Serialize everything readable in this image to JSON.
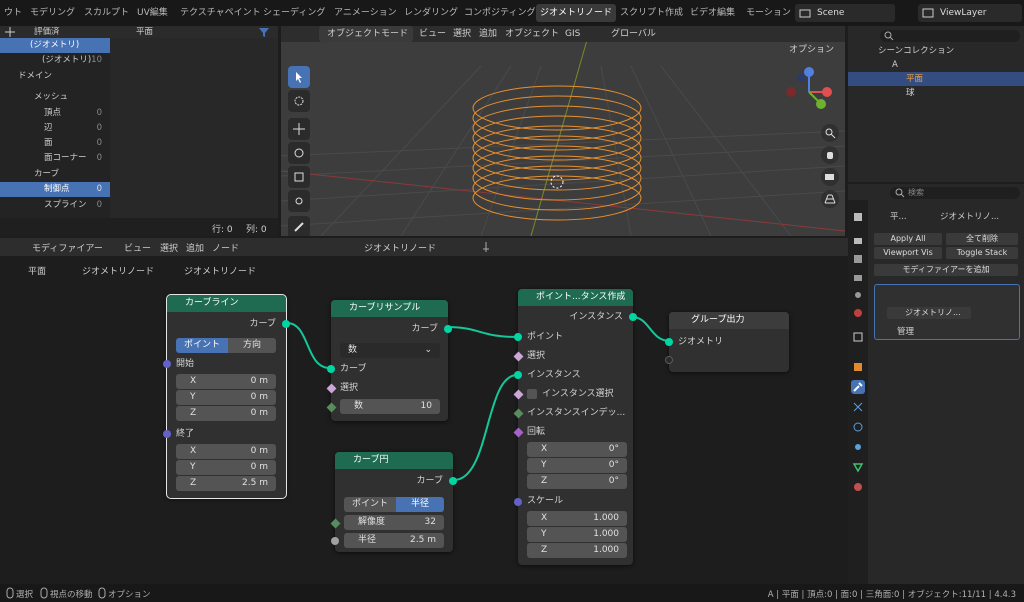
{
  "topbar": {
    "tabs": [
      "ウト",
      "モデリング",
      "スカルプト",
      "UV編集",
      "テクスチャペイント",
      "シェーディング",
      "アニメーション",
      "レンダリング",
      "コンポジティング",
      "ジオメトリノード",
      "スクリプト作成",
      "ビデオ編集",
      "モーション"
    ],
    "scene": "Scene",
    "view_layer": "ViewLayer"
  },
  "left_panel": {
    "header_label": "評価済",
    "rows": [
      {
        "label": "(ジオメトリ)",
        "count": "",
        "selected": true
      },
      {
        "label": "(ジオメトリ)",
        "count": "10",
        "selected": false
      },
      {
        "label": "ドメイン",
        "count": "",
        "selected": false
      },
      {
        "label": "メッシュ",
        "count": "",
        "selected": false
      },
      {
        "label": "頂点",
        "count": "0",
        "selected": false
      },
      {
        "label": "辺",
        "count": "0",
        "selected": false
      },
      {
        "label": "面",
        "count": "0",
        "selected": false
      },
      {
        "label": "面コーナー",
        "count": "0",
        "selected": false
      },
      {
        "label": "カーブ",
        "count": "",
        "selected": false
      },
      {
        "label": "制御点",
        "count": "0",
        "selected": true
      },
      {
        "label": "スプライン",
        "count": "0",
        "selected": false
      }
    ],
    "object_label": "平面",
    "footer_rows": "行: 0",
    "footer_cols": "列: 0"
  },
  "viewport": {
    "mode": "オブジェクトモード",
    "menus": [
      "ビュー",
      "選択",
      "追加",
      "オブジェクト",
      "GIS"
    ],
    "transform": "グローバル",
    "options": "オプション"
  },
  "outliner": {
    "search_placeholder": "",
    "collection": "シーンコレクション",
    "items": [
      {
        "label": "A"
      },
      {
        "label": "平面"
      },
      {
        "label": "球"
      }
    ]
  },
  "properties": {
    "search_placeholder": "検索",
    "breadcrumb_obj": "平...",
    "breadcrumb_mod": "ジオメトリノ...",
    "apply_all": "Apply All",
    "delete_all": "全て削除",
    "viewport_vis": "Viewport Vis",
    "toggle_stack": "Toggle Stack",
    "add_modifier": "モディファイアーを追加",
    "nodetree_name": "ジオメトリノ...",
    "manage": "管理"
  },
  "node_header": {
    "editor": "モディファイアー",
    "menus": [
      "ビュー",
      "選択",
      "追加",
      "ノード"
    ],
    "tree_name": "ジオメトリノード"
  },
  "breadcrumb": {
    "object": "平面",
    "modifier": "ジオメトリノード",
    "tree": "ジオメトリノード"
  },
  "nodes": {
    "curve_line": {
      "title": "カーブライン",
      "out": "カーブ",
      "mode_a": "ポイント",
      "mode_b": "方向",
      "start": "開始",
      "start_x": "0 m",
      "start_y": "0 m",
      "start_z": "0 m",
      "end": "終了",
      "end_x": "0 m",
      "end_y": "0 m",
      "end_z": "2.5 m",
      "x": "X",
      "y": "Y",
      "z": "Z"
    },
    "resample": {
      "title": "カーブリサンプル",
      "out": "カーブ",
      "mode": "数",
      "in_curve": "カーブ",
      "in_sel": "選択",
      "count_label": "数",
      "count_value": "10"
    },
    "circle": {
      "title": "カーブ円",
      "out": "カーブ",
      "mode_a": "ポイント",
      "mode_b": "半径",
      "res_label": "解像度",
      "res_value": "32",
      "rad_label": "半径",
      "rad_value": "2.5 m"
    },
    "instance": {
      "title": "ポイント...タンス作成",
      "out": "インスタンス",
      "points": "ポイント",
      "sel": "選択",
      "instance": "インスタンス",
      "inst_sel": "インスタンス選択",
      "inst_index": "インスタンスインデッ...",
      "rotation": "回転",
      "rot_x": "0°",
      "rot_y": "0°",
      "rot_z": "0°",
      "scale": "スケール",
      "sc_x": "1.000",
      "sc_y": "1.000",
      "sc_z": "1.000",
      "x": "X",
      "y": "Y",
      "z": "Z"
    },
    "group_output": {
      "title": "グループ出力",
      "geometry": "ジオメトリ"
    }
  },
  "statusbar": {
    "select": "選択",
    "move": "視点の移動",
    "options": "オプション",
    "stats": "A | 平面 | 頂点:0 | 面:0 | 三角面:0 | オブジェクト:11/11 | 4.4.3"
  },
  "colors": {
    "accent": "#4772b3",
    "geometry_socket": "#00d6a3",
    "node_green": "#1e6b52",
    "spiral": "#e8902e"
  }
}
